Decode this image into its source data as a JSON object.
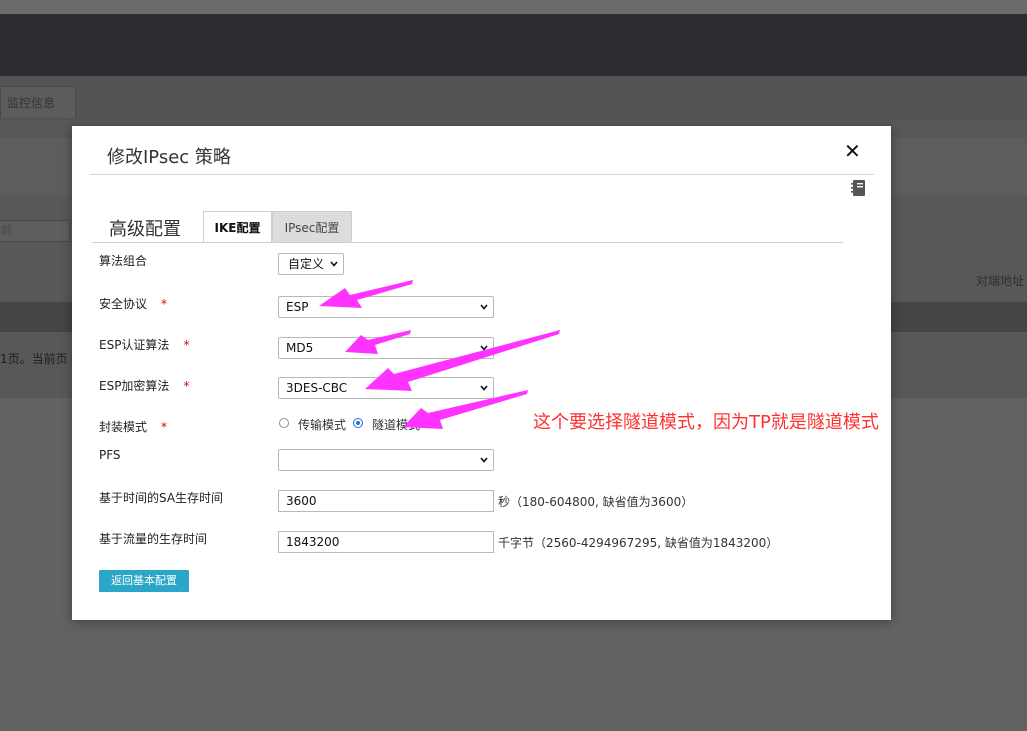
{
  "background": {
    "tab_label": "监控信息",
    "input_text": "前",
    "right_label": "对端地址",
    "pagination_text": "1页。当前页"
  },
  "modal": {
    "title": "修改IPsec 策略",
    "close_label": "✕",
    "section_title": "高级配置",
    "tabs": [
      {
        "label": "IKE配置",
        "active": true
      },
      {
        "label": "IPsec配置",
        "active": false
      }
    ],
    "fields": {
      "algorithm_combo": {
        "label": "算法组合",
        "value": "自定义"
      },
      "security_protocol": {
        "label": "安全协议",
        "required": "*",
        "value": "ESP"
      },
      "esp_auth": {
        "label": "ESP认证算法",
        "required": "*",
        "value": "MD5"
      },
      "esp_encrypt": {
        "label": "ESP加密算法",
        "required": "*",
        "value": "3DES-CBC"
      },
      "encap_mode": {
        "label": "封装模式",
        "required": "*",
        "options": [
          {
            "label": "传输模式",
            "selected": false
          },
          {
            "label": "隧道模式",
            "selected": true
          }
        ]
      },
      "pfs": {
        "label": "PFS",
        "value": ""
      },
      "sa_lifetime_time": {
        "label": "基于时间的SA生存时间",
        "value": "3600",
        "hint": "秒（180-604800, 缺省值为3600）"
      },
      "sa_lifetime_traffic": {
        "label": "基于流量的生存时间",
        "value": "1843200",
        "hint": "千字节（2560-4294967295, 缺省值为1843200）"
      }
    },
    "back_button": "返回基本配置"
  },
  "annotation": {
    "note": "这个要选择隧道模式，因为TP就是隧道模式",
    "color": "#ff3030",
    "arrow_color": "#ff33ff"
  },
  "colors": {
    "button": "#2aa7c8",
    "required": "#dd0000",
    "radio_selected": "#1e6fd9"
  }
}
